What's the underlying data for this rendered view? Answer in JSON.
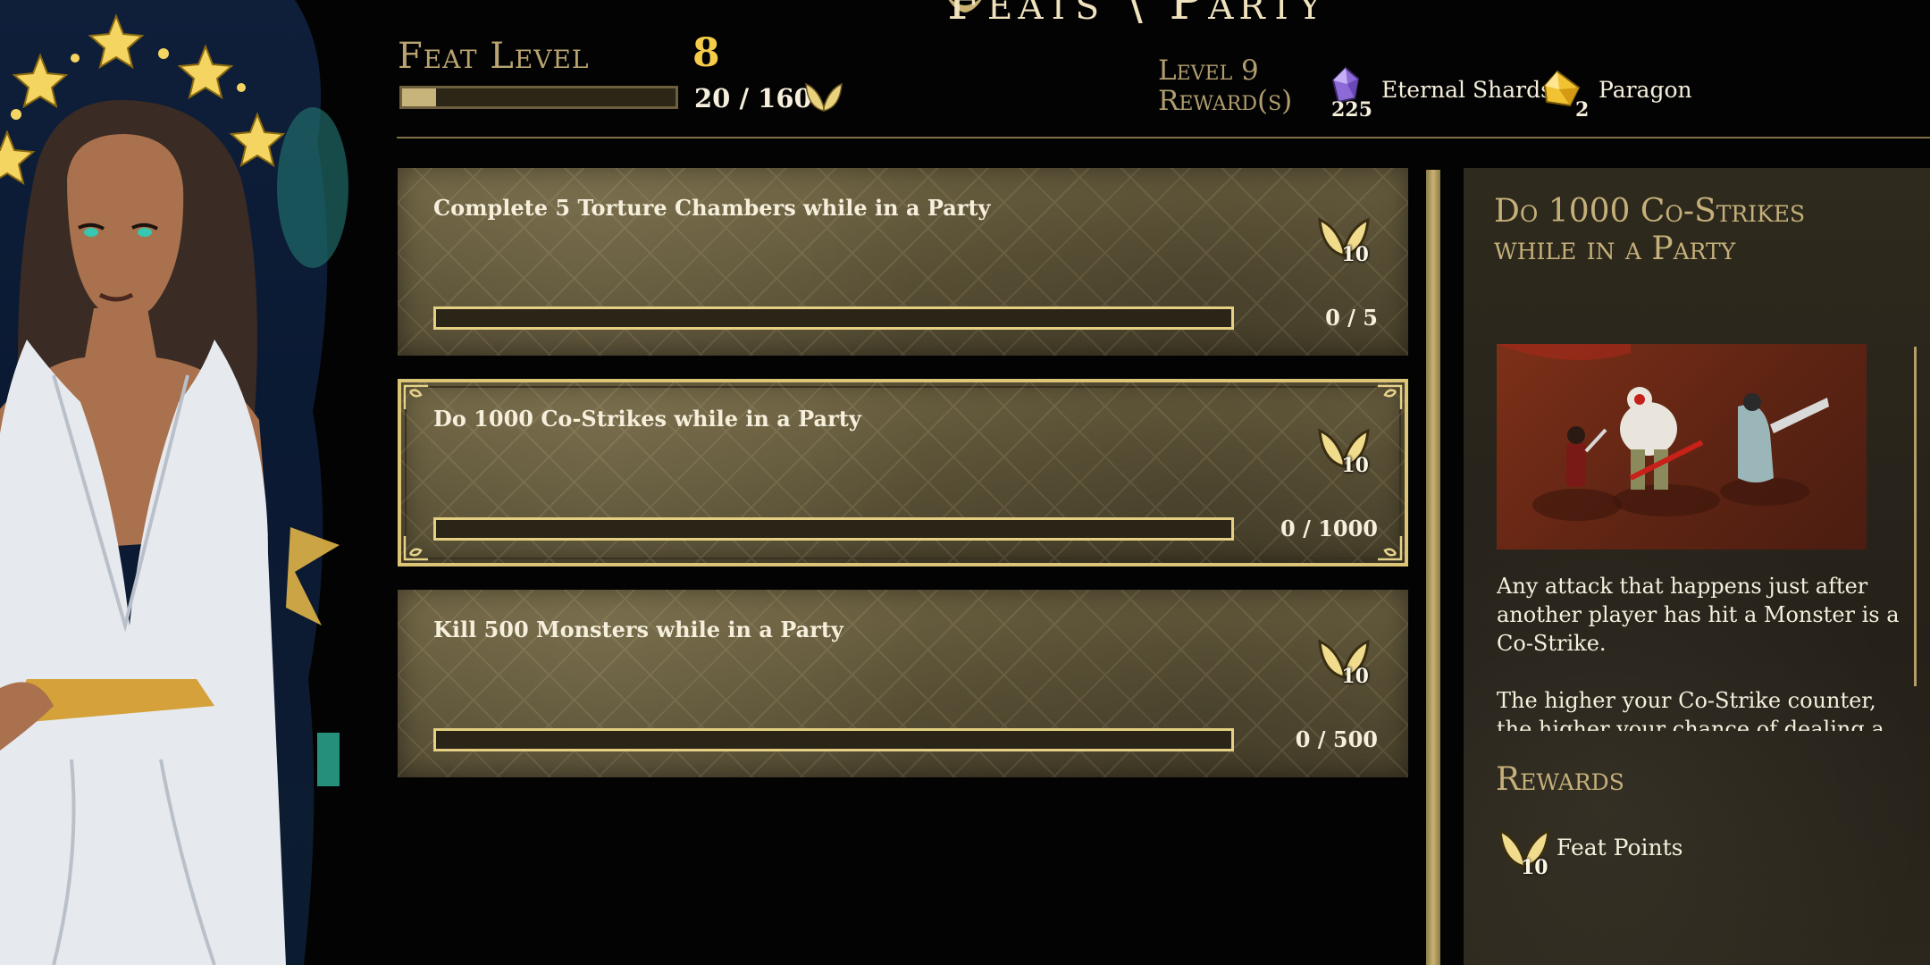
{
  "screen": {
    "title": "Feats \\ Party"
  },
  "header": {
    "feat_level_label": "Feat Level",
    "feat_level_value": "8",
    "feat_progress_text": "20 / 160",
    "feat_progress_fraction": 0.125,
    "reward_level_label_line1": "Level 9",
    "reward_level_label_line2": "Reward(s)",
    "rewards": [
      {
        "name": "Eternal Shards",
        "count": "225",
        "icon": "purple-crystal-icon"
      },
      {
        "name": "Paragon",
        "count": "2",
        "icon": "gold-gem-icon"
      }
    ]
  },
  "feats": [
    {
      "title": "Complete 5 Torture Chambers while in a Party",
      "reward": "10",
      "progress_text": "0 / 5",
      "progress_fraction": 0,
      "selected": false
    },
    {
      "title": "Do 1000 Co-Strikes while in a Party",
      "reward": "10",
      "progress_text": "0 / 1000",
      "progress_fraction": 0,
      "selected": true
    },
    {
      "title": "Kill 500 Monsters while in a Party",
      "reward": "10",
      "progress_text": "0 / 500",
      "progress_fraction": 0,
      "selected": false
    }
  ],
  "detail": {
    "title": "Do 1000 Co-Strikes while in a Party",
    "description_p1": "Any attack that happens just after another player has hit a Monster is a Co-Strike.",
    "description_p2": "The higher your Co-Strike counter, the higher your chance of dealing a",
    "rewards_heading": "Rewards",
    "reward_value": "10",
    "reward_label": "Feat Points"
  },
  "colors": {
    "accent_gold": "#f4cc4a",
    "label_gold": "#b9a471",
    "card_bg": "#5d5438",
    "panel_bg": "#2a261c"
  }
}
